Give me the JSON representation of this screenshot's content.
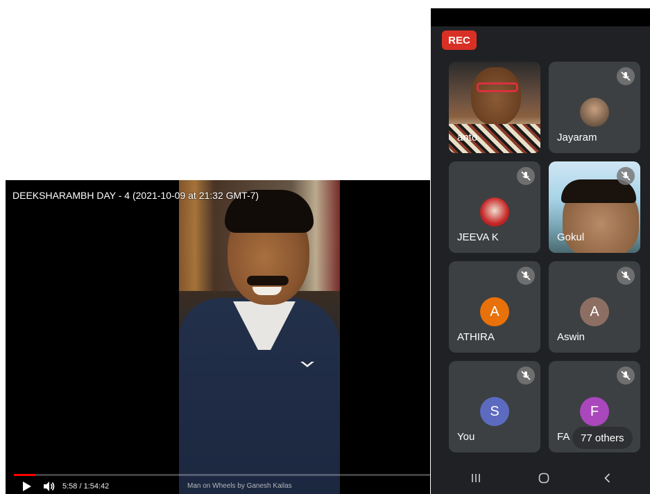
{
  "video": {
    "title": "DEEKSHARAMBH DAY - 4 (2021-10-09 at 21:32 GMT-7)",
    "time": "5:58 / 1:54:42",
    "caption": "Man on Wheels by Ganesh Kailas",
    "progress_fraction": 0.052,
    "play_icon": "play-icon",
    "volume_icon": "volume-icon"
  },
  "meet": {
    "rec_label": "REC",
    "participants": [
      {
        "name": "anto",
        "type": "video",
        "muted": false
      },
      {
        "name": "Jayaram",
        "type": "photo-avatar",
        "muted": true
      },
      {
        "name": "JEEVA K",
        "type": "photo-avatar",
        "muted": true
      },
      {
        "name": "Gokul",
        "type": "video",
        "muted": true
      },
      {
        "name": "ATHIRA",
        "initial": "A",
        "avatar_color": "#e8710a",
        "muted": true
      },
      {
        "name": "Aswin",
        "initial": "A",
        "avatar_color": "#8d6e63",
        "muted": true
      },
      {
        "name": "You",
        "initial": "S",
        "avatar_color": "#5c6bc0",
        "muted": true
      },
      {
        "name": "FA",
        "initial": "F",
        "avatar_color": "#ab47bc",
        "muted": true
      }
    ],
    "others_label": "77 others"
  },
  "colors": {
    "rec": "#d93025",
    "panel_bg": "#202124",
    "tile_bg": "#3c4043",
    "progress": "#ff0000"
  },
  "navbar": {
    "items": [
      "recents-icon",
      "home-icon",
      "back-icon"
    ]
  }
}
